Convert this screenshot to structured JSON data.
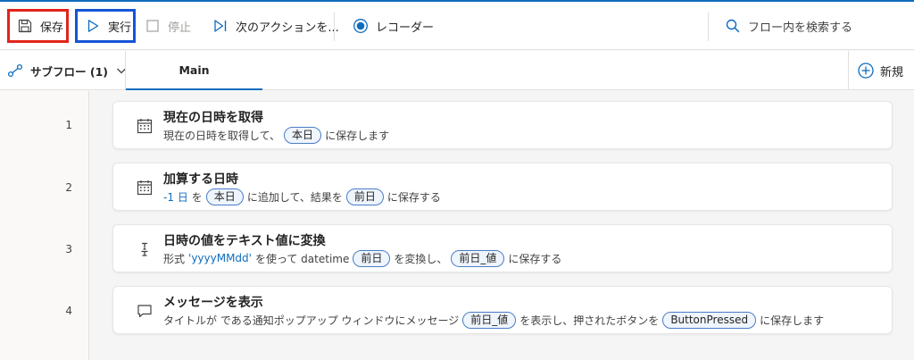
{
  "toolbar": {
    "save_label": "保存",
    "run_label": "実行",
    "stop_label": "停止",
    "next_label": "次のアクションを...",
    "recorder_label": "レコーダー",
    "search_placeholder": "フロー内を検索する"
  },
  "tabs": {
    "subflow_label": "サブフロー (1)",
    "main_label": "Main",
    "new_label": "新規"
  },
  "actions": [
    {
      "line": "1",
      "title": "現在の日時を取得",
      "desc": {
        "t1": "現在の日時を取得して、",
        "var": "本日",
        "t2": "に保存します"
      }
    },
    {
      "line": "2",
      "title": "加算する日時",
      "desc": {
        "num": "-1 日",
        "t1": "を",
        "var1": "本日",
        "t2": "に追加して、結果を",
        "var2": "前日",
        "t3": "に保存する"
      }
    },
    {
      "line": "3",
      "title": "日時の値をテキスト値に変換",
      "desc": {
        "t1": "形式",
        "fmt": "'yyyyMMdd'",
        "t2": "を使って datetime",
        "var1": "前日",
        "t3": "を変換し、",
        "var2": "前日_値",
        "t4": "に保存する"
      }
    },
    {
      "line": "4",
      "title": "メッセージを表示",
      "desc": {
        "t1": "タイトルが  である通知ポップアップ ウィンドウにメッセージ",
        "var1": "前日_値",
        "t2": "を表示し、押されたボタンを",
        "var2": "ButtonPressed",
        "t3": "に保存します"
      }
    }
  ],
  "colors": {
    "accent": "#0f6cbd",
    "save_highlight": "#e2231a",
    "run_highlight": "#1555d6"
  }
}
